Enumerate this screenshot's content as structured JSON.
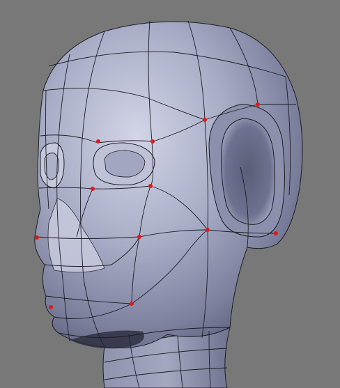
{
  "viewport": {
    "background_color": "#787878",
    "mesh_color": "#9aa0bc",
    "mesh_shadow_color": "#2a2c3c",
    "wire_color": "#1c1c24",
    "vertex_color": "#e01a1a",
    "selected_vertex_count": 14
  }
}
